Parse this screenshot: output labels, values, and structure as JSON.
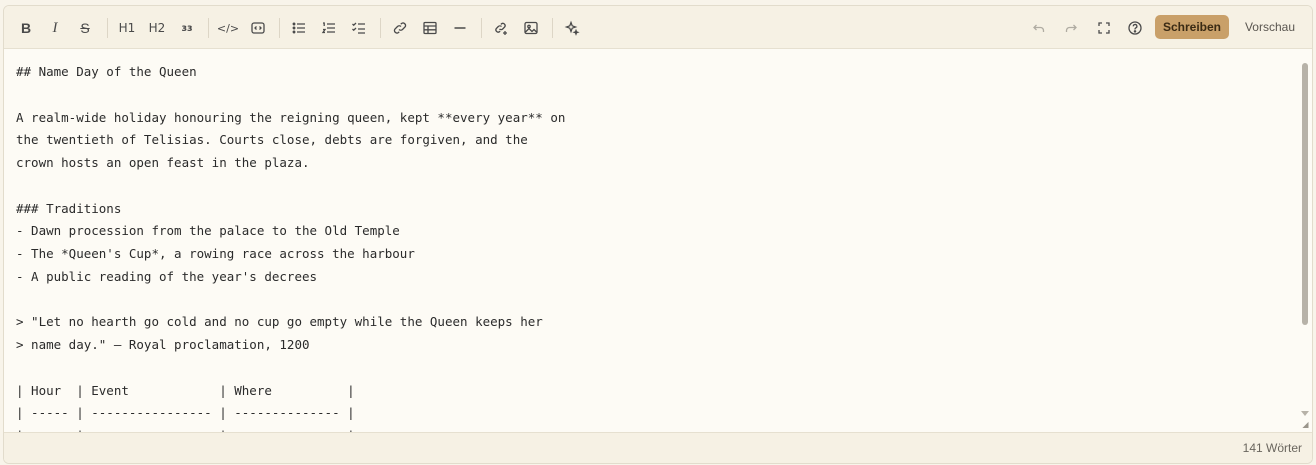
{
  "toolbar": {
    "bold": "B",
    "italic": "I",
    "strike": "S",
    "h1": "H1",
    "h2": "H2",
    "h3": "ɜɜ",
    "code": "</>",
    "mode_write": "Schreiben",
    "mode_preview": "Vorschau"
  },
  "editor": {
    "lines": [
      "## Name Day of the Queen",
      "",
      "A realm-wide holiday honouring the reigning queen, kept **every year** on",
      "the twentieth of Telisias. Courts close, debts are forgiven, and the",
      "crown hosts an open feast in the plaza.",
      "",
      "### Traditions",
      "- Dawn procession from the palace to the Old Temple",
      "- The *Queen's Cup*, a rowing race across the harbour",
      "- A public reading of the year's decrees",
      "",
      "> \"Let no hearth go cold and no cup go empty while the Queen keeps her",
      "> name day.\" — Royal proclamation, 1200",
      "",
      "| Hour  | Event            | Where          |",
      "| ----- | ---------------- | -------------- |",
      "| ----- | ---------------- | -------------- |"
    ]
  },
  "status": {
    "word_count": "141 Wörter"
  }
}
